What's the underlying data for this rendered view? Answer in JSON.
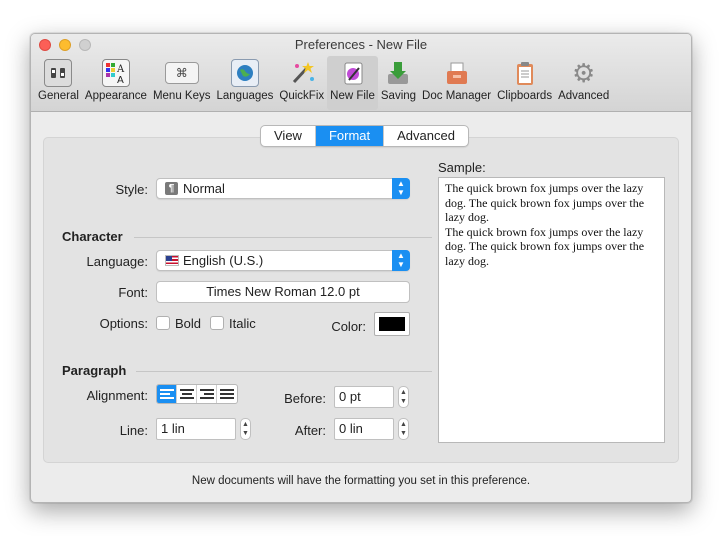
{
  "window": {
    "title": "Preferences - New File",
    "colors": {
      "close": "#fc5f57",
      "minimize": "#fdbc2e",
      "zoom": "#d0d0d0",
      "accent": "#1a8ff2"
    }
  },
  "toolbar": {
    "items": [
      {
        "label": "General",
        "icon": "switches-icon"
      },
      {
        "label": "Appearance",
        "icon": "palette-icon"
      },
      {
        "label": "Menu Keys",
        "icon": "command-key-icon"
      },
      {
        "label": "Languages",
        "icon": "globe-flag-icon"
      },
      {
        "label": "QuickFix",
        "icon": "magic-wand-icon"
      },
      {
        "label": "New File",
        "icon": "new-file-icon"
      },
      {
        "label": "Saving",
        "icon": "download-icon"
      },
      {
        "label": "Doc Manager",
        "icon": "tray-icon"
      },
      {
        "label": "Clipboards",
        "icon": "clipboard-icon"
      },
      {
        "label": "Advanced",
        "icon": "gear-icon"
      }
    ],
    "selected": "New File"
  },
  "tabs": {
    "items": [
      "View",
      "Format",
      "Advanced"
    ],
    "active": "Format"
  },
  "form": {
    "style_label": "Style:",
    "style_value": "Normal",
    "character_title": "Character",
    "language_label": "Language:",
    "language_value": "English (U.S.)",
    "font_label": "Font:",
    "font_value": "Times New Roman 12.0 pt",
    "options_label": "Options:",
    "bold_label": "Bold",
    "italic_label": "Italic",
    "color_label": "Color:",
    "color_value": "#000000",
    "paragraph_title": "Paragraph",
    "alignment_label": "Alignment:",
    "alignment_options": [
      "left",
      "center",
      "right",
      "justify"
    ],
    "alignment_selected": "left",
    "before_label": "Before:",
    "before_value": "0 pt",
    "line_label": "Line:",
    "line_value": "1 lin",
    "after_label": "After:",
    "after_value": "0 lin"
  },
  "sample": {
    "label": "Sample:",
    "text_1": "The quick brown fox jumps over the lazy dog. The quick brown fox jumps over the lazy dog.",
    "text_2": "The quick brown fox jumps over the lazy dog. The quick brown fox jumps over the lazy dog."
  },
  "footer": {
    "note": "New documents will have the formatting you set in this preference."
  }
}
